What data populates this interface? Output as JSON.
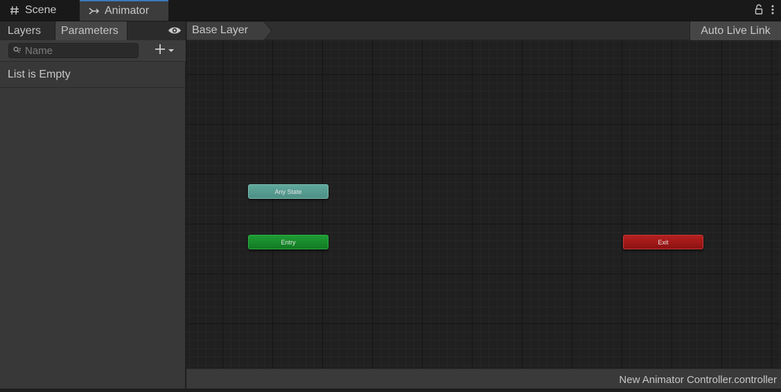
{
  "tabs": [
    {
      "label": "Scene",
      "icon": "hash-icon"
    },
    {
      "label": "Animator",
      "icon": "animator-icon",
      "active": true
    }
  ],
  "left_panel": {
    "tabs": [
      {
        "label": "Layers"
      },
      {
        "label": "Parameters",
        "active": true
      }
    ],
    "search_placeholder": "Name",
    "empty_message": "List is Empty"
  },
  "graph": {
    "breadcrumb": "Base Layer",
    "auto_live_link": "Auto Live Link",
    "nodes": {
      "any_state": "Any State",
      "entry": "Entry",
      "exit": "Exit"
    },
    "status": "New Animator Controller.controller"
  },
  "colors": {
    "accent_tab": "#3a79bb",
    "any_state": "#5fa89c",
    "entry": "#1e9c34",
    "exit": "#b51f1f"
  }
}
